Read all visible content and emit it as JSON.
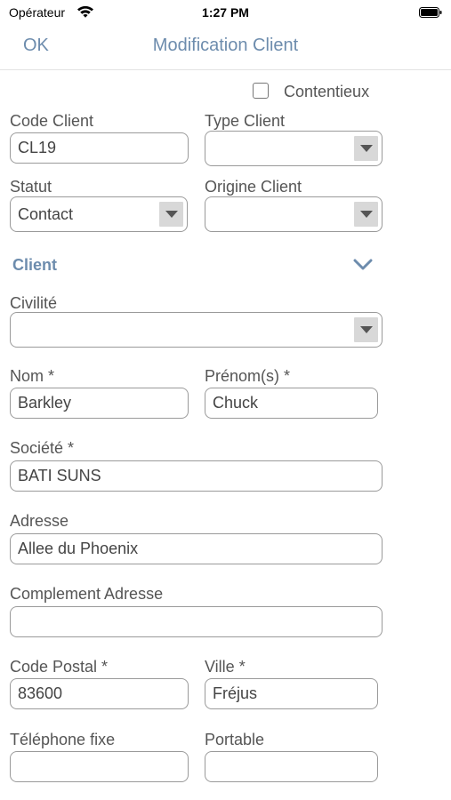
{
  "status_bar": {
    "carrier": "Opérateur",
    "time": "1:27 PM"
  },
  "nav": {
    "ok_label": "OK",
    "title": "Modification Client"
  },
  "contentieux": {
    "label": "Contentieux",
    "checked": false
  },
  "form": {
    "code_client": {
      "label": "Code Client",
      "value": "CL19"
    },
    "type_client": {
      "label": "Type Client",
      "value": ""
    },
    "statut": {
      "label": "Statut",
      "value": "Contact"
    },
    "origine_client": {
      "label": "Origine Client",
      "value": ""
    },
    "section_client": {
      "title": "Client"
    },
    "civilite": {
      "label": "Civilité",
      "value": ""
    },
    "nom": {
      "label": "Nom *",
      "value": "Barkley"
    },
    "prenom": {
      "label": "Prénom(s) *",
      "value": "Chuck"
    },
    "societe": {
      "label": "Société *",
      "value": "BATI SUNS"
    },
    "adresse": {
      "label": "Adresse",
      "value": "Allee du Phoenix"
    },
    "complement_adresse": {
      "label": "Complement Adresse",
      "value": ""
    },
    "code_postal": {
      "label": "Code Postal *",
      "value": "83600"
    },
    "ville": {
      "label": "Ville *",
      "value": "Fréjus"
    },
    "telephone_fixe": {
      "label": "Téléphone fixe",
      "value": ""
    },
    "portable": {
      "label": "Portable",
      "value": ""
    }
  },
  "colors": {
    "accent": "#6d8cad",
    "field_border": "#9a9a9a",
    "dropdown_button": "#d8d8d8"
  },
  "icons": [
    "wifi-icon",
    "battery-icon",
    "checkbox-icon",
    "chevron-down-icon",
    "dropdown-arrow-icon"
  ]
}
